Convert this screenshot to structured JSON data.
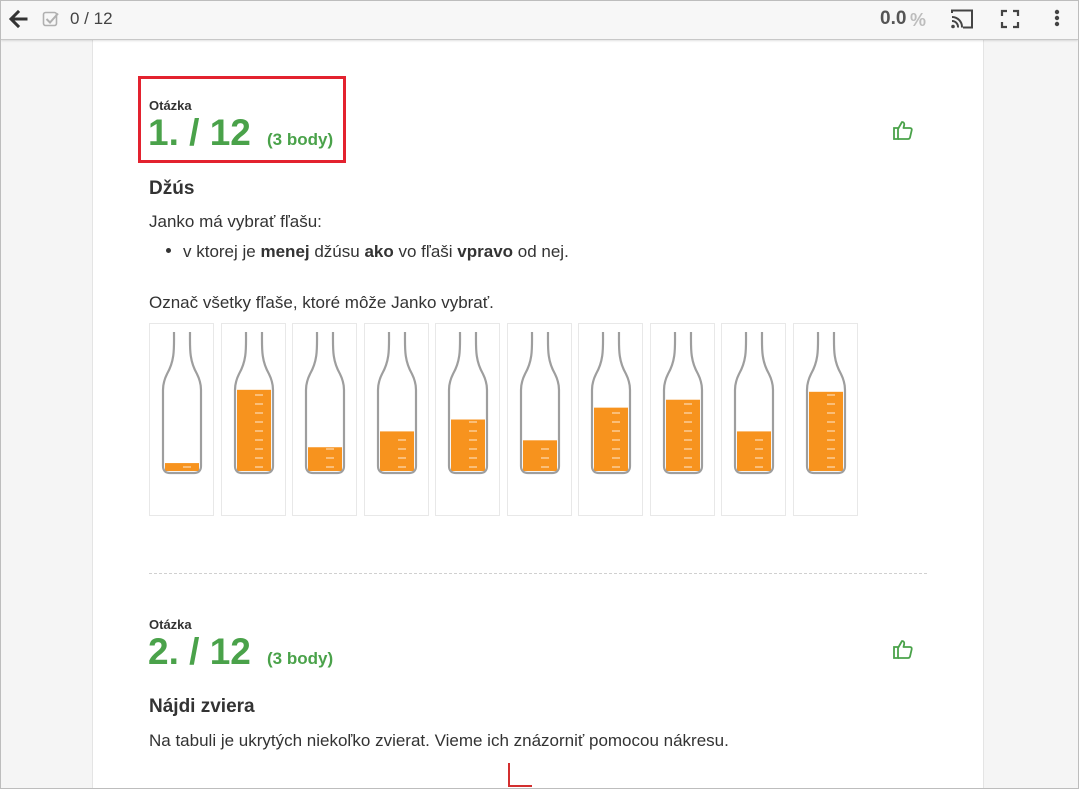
{
  "toolbar": {
    "progress": "0 / 12",
    "score": "0.0",
    "score_unit": "%"
  },
  "questions": [
    {
      "label": "Otázka",
      "number": "1. / 12",
      "points": "(3 body)",
      "title": "Džús",
      "intro": "Janko má vybrať fľašu:",
      "bullet": {
        "p1": "v ktorej je ",
        "b1": "menej",
        "p2": " džúsu ",
        "b2": "ako",
        "p3": " vo fľaši ",
        "b3": "vpravo",
        "p4": " od nej."
      },
      "instruction": "Označ všetky fľaše, ktoré môže Janko vybrať.",
      "bottle_fill_levels": [
        0.08,
        0.82,
        0.24,
        0.4,
        0.52,
        0.31,
        0.64,
        0.72,
        0.4,
        0.8
      ]
    },
    {
      "label": "Otázka",
      "number": "2. / 12",
      "points": "(3 body)",
      "title": "Nájdi zviera",
      "intro": "Na tabuli je ukrytých niekoľko zvierat. Vieme ich znázorniť pomocou nákresu."
    }
  ],
  "colors": {
    "accent_green": "#4aa24a",
    "juice_orange": "#f7931e",
    "highlight_red": "#e3222f"
  },
  "icons": {
    "back": "arrow-left-icon",
    "check": "checkbox-icon",
    "cast": "cast-icon",
    "fullscreen": "fullscreen-icon",
    "more": "more-vertical-icon",
    "like": "thumbs-up-icon"
  }
}
